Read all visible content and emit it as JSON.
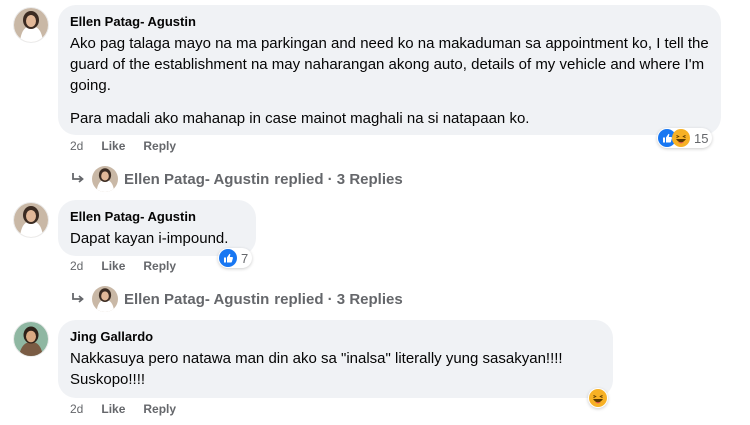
{
  "comments": [
    {
      "author": "Ellen Patag- Agustin",
      "paragraphs": [
        "Ako pag talaga mayo na ma parkingan and need ko na makaduman sa appointment ko, I tell the guard of the establishment na may naharangan akong auto, details of my vehicle and where I'm going.",
        "Para madali ako mahanap in case mainot maghali na si natapaan ko."
      ],
      "time": "2d",
      "like_label": "Like",
      "reply_label": "Reply",
      "reactions": [
        "like",
        "haha"
      ],
      "reaction_count": "15",
      "replies_summary": {
        "name": "Ellen Patag- Agustin",
        "text": "replied · 3 Replies"
      }
    },
    {
      "author": "Ellen Patag- Agustin",
      "paragraphs": [
        "Dapat kayan i-impound."
      ],
      "time": "2d",
      "like_label": "Like",
      "reply_label": "Reply",
      "reactions": [
        "like"
      ],
      "reaction_count": "7",
      "replies_summary": {
        "name": "Ellen Patag- Agustin",
        "text": "replied · 3 Replies"
      }
    },
    {
      "author": "Jing Gallardo",
      "paragraphs": [
        "Nakkasuya pero natawa man din ako sa \"inalsa\" literally yung sasakyan!!!! Suskopo!!!!"
      ],
      "time": "2d",
      "like_label": "Like",
      "reply_label": "Reply",
      "reactions": [
        "haha"
      ],
      "reaction_count": ""
    }
  ],
  "colors": {
    "bubble": "#f0f2f5",
    "meta_text": "#65676b",
    "like_blue": "#1877f2",
    "haha_yellow": "#f7b125"
  }
}
